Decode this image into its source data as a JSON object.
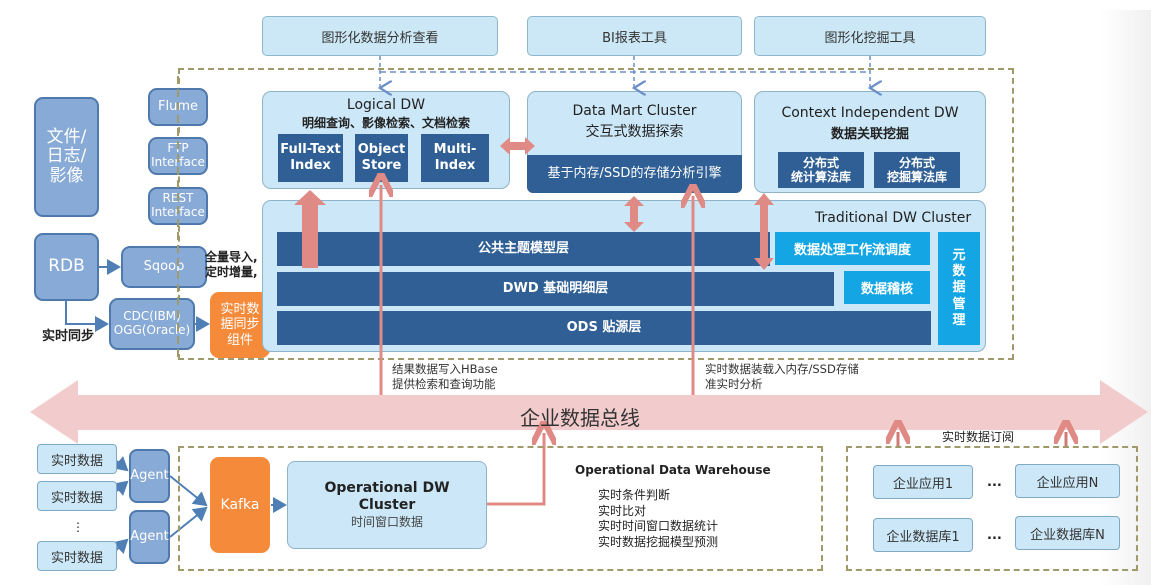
{
  "top_tools": [
    {
      "label": "图形化数据分析查看"
    },
    {
      "label": "BI报表工具"
    },
    {
      "label": "图形化挖掘工具"
    }
  ],
  "sources": {
    "files": "文件/\n日志/\n影像",
    "rdb": "RDB",
    "flume": "Flume",
    "ftp": "FTP\nInterface",
    "rest": "REST\nInterface",
    "sqoop": "Sqoop",
    "cdc": "CDC(IBM)\nOGG(Oracle)",
    "realtime_sync_label": "实时同步",
    "sqoop_note": "全量导入,\n定时增量,",
    "sync_component": "实时数\n据同步\n组件"
  },
  "logical_dw": {
    "title": "Logical DW",
    "subtitle": "明细查询、影像检索、文档检索",
    "indexes": [
      "Full-Text\nIndex",
      "Object\nStore",
      "Multi-\nIndex"
    ]
  },
  "data_mart": {
    "title": "Data Mart Cluster",
    "subtitle": "交互式数据探索",
    "engine": "基于内存/SSD的存储分析引擎"
  },
  "context_dw": {
    "title": "Context Independent DW",
    "subtitle": "数据关联挖掘",
    "libs": [
      "分布式\n统计算法库",
      "分布式\n挖掘算法库"
    ]
  },
  "traditional_dw": {
    "title": "Traditional DW Cluster",
    "layers": [
      "公共主题模型层",
      "DWD 基础明细层",
      "ODS 贴源层"
    ],
    "workflow": "数据处理工作流调度",
    "audit": "数据稽核",
    "metadata": "元\n数\n据\n管\n理"
  },
  "notes": {
    "hbase": "结果数据写入HBase\n提供检索和查询功能",
    "ssd": "实时数据装载入内存/SSD存储\n准实时分析",
    "subscribe": "实时数据订阅"
  },
  "bus": {
    "label": "企业数据总线"
  },
  "realtime": {
    "inputs": [
      "实时数据",
      "实时数据",
      "实时数据"
    ],
    "ellipsis": "⋮",
    "agents": [
      "Agent",
      "Agent"
    ],
    "kafka": "Kafka",
    "odw_title": "Operational DW\nCluster",
    "odw_sub": "时间窗口数据",
    "odw_heading": "Operational Data Warehouse",
    "odw_items": [
      "实时条件判断",
      "实时比对",
      "实时时间窗口数据统计",
      "实时数据挖掘模型预测"
    ]
  },
  "enterprise": {
    "apps": [
      "企业应用1",
      "企业应用N"
    ],
    "dbs": [
      "企业数据库1",
      "企业数据库N"
    ],
    "ellipsis": "..."
  },
  "colors": {
    "panel": "#cce8f8",
    "dark_blue": "#2f5f94",
    "cyan": "#14a6e4",
    "orange": "#f48a3a",
    "arrow_pink": "#e08a86",
    "bus_pink": "#f2cccc",
    "dashed": "#a09a6a"
  }
}
